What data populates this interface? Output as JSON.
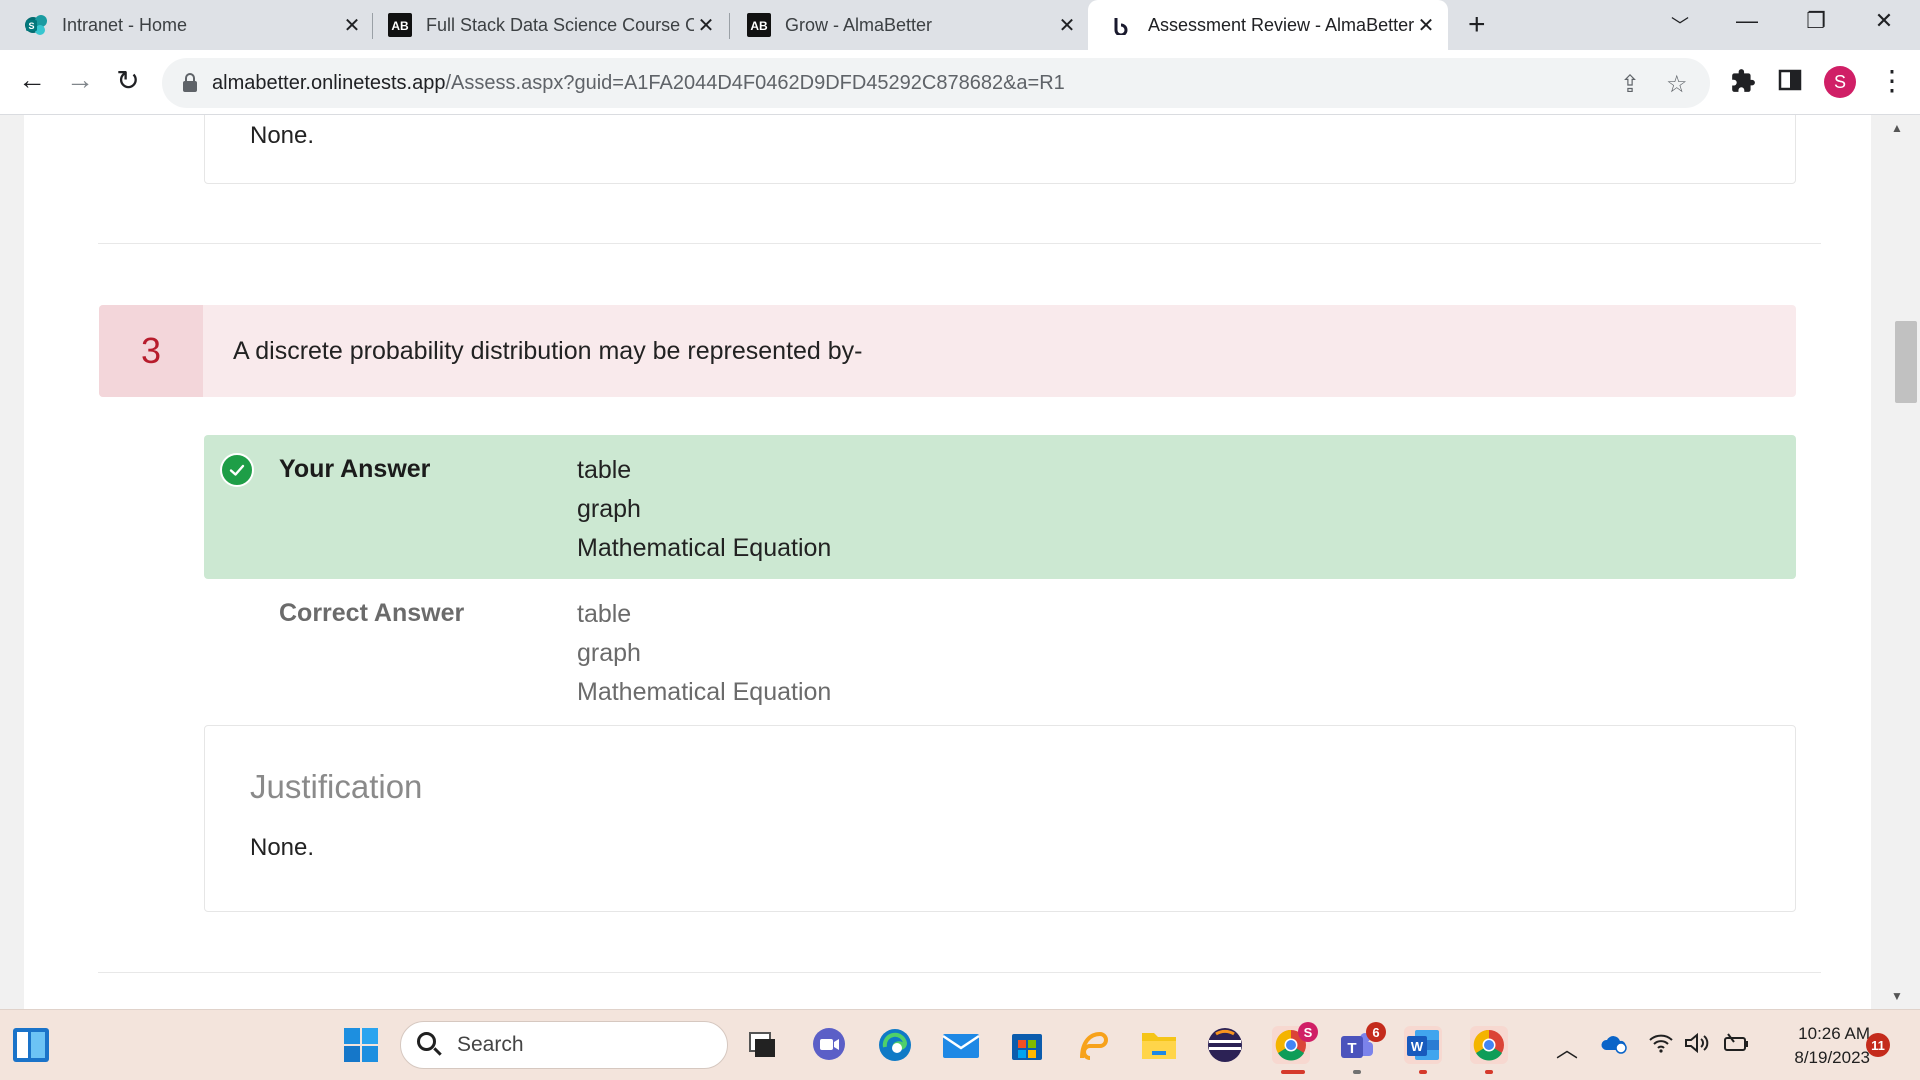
{
  "browser": {
    "tabs": [
      {
        "title": "Intranet - Home",
        "icon": "sharepoint-icon"
      },
      {
        "title": "Full Stack Data Science Course O",
        "icon": "almabetter-icon"
      },
      {
        "title": "Grow - AlmaBetter",
        "icon": "almabetter-icon"
      },
      {
        "title": "Assessment Review - AlmaBetter",
        "icon": "loading-icon",
        "active": true
      }
    ],
    "url_host": "almabetter.onlinetests.app",
    "url_path": "/Assess.aspx?guid=A1FA2044D4F0462D9DFD45292C878682&a=R1",
    "profile_initial": "S"
  },
  "previous": {
    "justification_text": "None."
  },
  "question": {
    "number": "3",
    "text": "A discrete probability distribution may be represented by-",
    "your_answer_label": "Your Answer",
    "your_answer": [
      "table",
      "graph",
      "Mathematical Equation"
    ],
    "correct_answer_label": "Correct Answer",
    "correct_answer": [
      "table",
      "graph",
      "Mathematical Equation"
    ],
    "justification_title": "Justification",
    "justification_text": "None."
  },
  "taskbar": {
    "search_placeholder": "Search",
    "time": "10:26 AM",
    "date": "8/19/2023",
    "notification_count": "11",
    "teams_badge": "6",
    "chrome_badge": "S"
  },
  "colors": {
    "correct_bg": "#cce8d2",
    "check_green": "#1e9e47",
    "question_bg": "#f9eaec",
    "question_number": "#b71c2c"
  }
}
